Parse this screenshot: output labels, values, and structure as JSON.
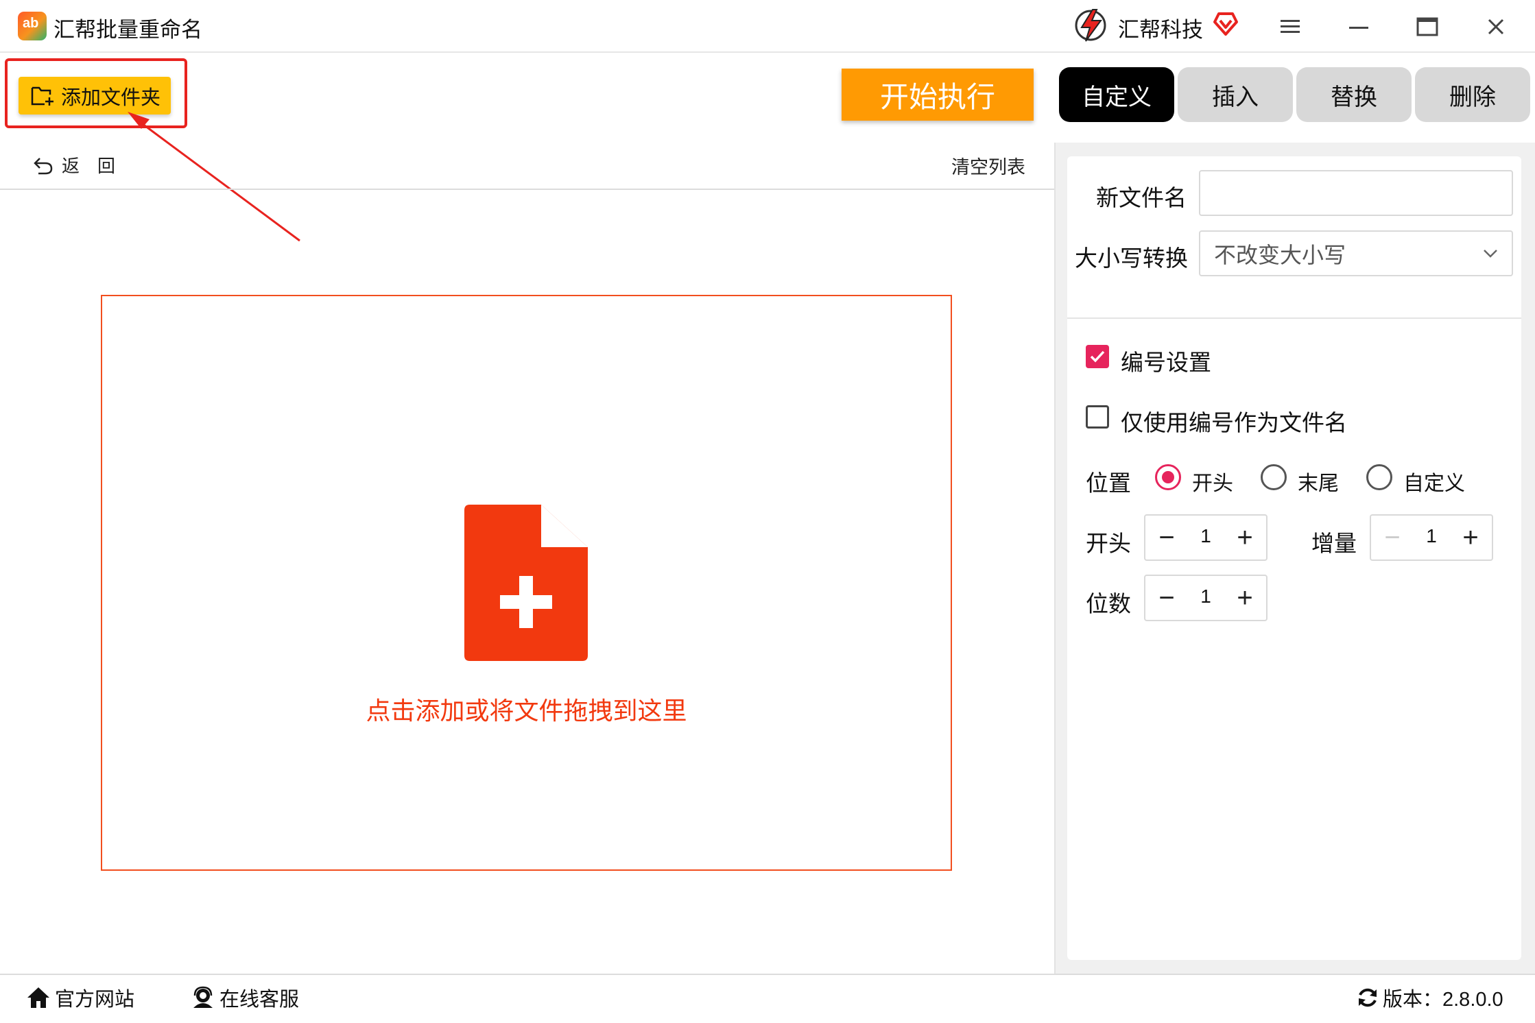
{
  "app": {
    "title": "汇帮批量重命名",
    "icon": "app-logo-icon"
  },
  "brand": {
    "name": "汇帮科技",
    "logo": "brand-logo-icon",
    "vip_icon": "vip-heart-icon"
  },
  "window_controls": {
    "menu": "menu-icon",
    "minimize": "minimize-icon",
    "maximize": "maximize-icon",
    "close": "close-icon"
  },
  "toolbar": {
    "add_folder": "添加文件夹",
    "start": "开始执行"
  },
  "tabs": [
    {
      "label": "自定义",
      "active": true
    },
    {
      "label": "插入",
      "active": false
    },
    {
      "label": "替换",
      "active": false
    },
    {
      "label": "删除",
      "active": false
    }
  ],
  "list": {
    "back": "返　回",
    "clear": "清空列表"
  },
  "dropzone": {
    "text": "点击添加或将文件拖拽到这里",
    "icon": "file-add-icon"
  },
  "form": {
    "new_filename_label": "新文件名",
    "new_filename_value": "",
    "case_label": "大小写转换",
    "case_value": "不改变大小写",
    "numbering_label": "编号设置",
    "numbering_checked": true,
    "only_number_label": "仅使用编号作为文件名",
    "only_number_checked": false,
    "position_label": "位置",
    "position_options": [
      {
        "label": "开头",
        "selected": true
      },
      {
        "label": "末尾",
        "selected": false
      },
      {
        "label": "自定义",
        "selected": false
      }
    ],
    "start_label": "开头",
    "start_value": "1",
    "increment_label": "增量",
    "increment_value": "1",
    "digits_label": "位数",
    "digits_value": "1"
  },
  "status": {
    "website": "官方网站",
    "support": "在线客服",
    "version": "版本：2.8.0.0"
  },
  "colors": {
    "accent": "#e6245c",
    "start": "#ff9a03",
    "add": "#ffc107",
    "drop": "#f2390f",
    "highlight": "#e8231f"
  }
}
